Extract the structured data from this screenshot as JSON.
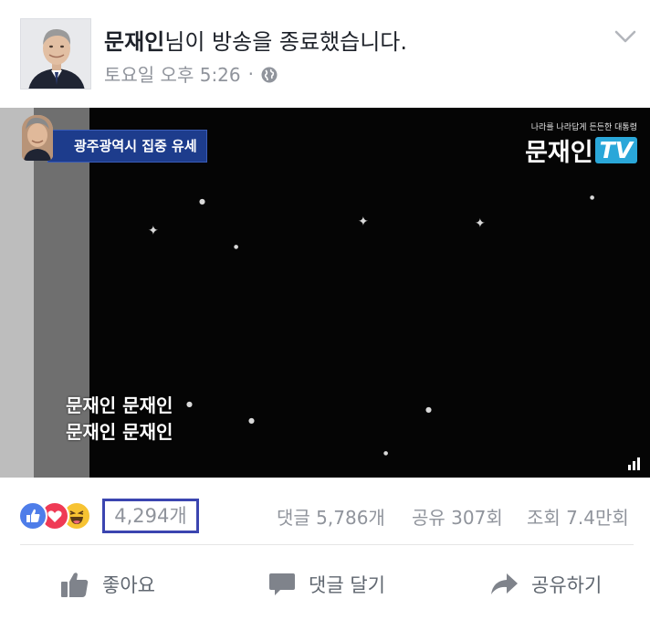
{
  "post": {
    "author": "문재인",
    "title_suffix": "님이 방송을 종료했습니다.",
    "timestamp": "토요일 오후 5:26",
    "separator": "·",
    "privacy_icon": "globe-icon",
    "menu_icon": "chevron-down-icon"
  },
  "video": {
    "caption_top": "광주광역시 집중 유세",
    "logo_slogan": "나라를 나라답게 든든한 대통령",
    "logo_name": "문재인",
    "logo_badge": "TV",
    "chant_line1": "문재인 문재인",
    "chant_line2": "문재인 문재인",
    "badge_color": "#2aa7d9",
    "caption_color": "#1d3c8c"
  },
  "stats": {
    "reaction_icons": [
      "like-reaction-icon",
      "love-reaction-icon",
      "haha-reaction-icon"
    ],
    "reaction_count": "4,294개",
    "comments": "댓글 5,786개",
    "shares": "공유 307회",
    "views": "조회 7.4만회",
    "highlight_color": "#3b45b0"
  },
  "actions": {
    "like_label": "좋아요",
    "comment_label": "댓글 달기",
    "share_label": "공유하기"
  }
}
